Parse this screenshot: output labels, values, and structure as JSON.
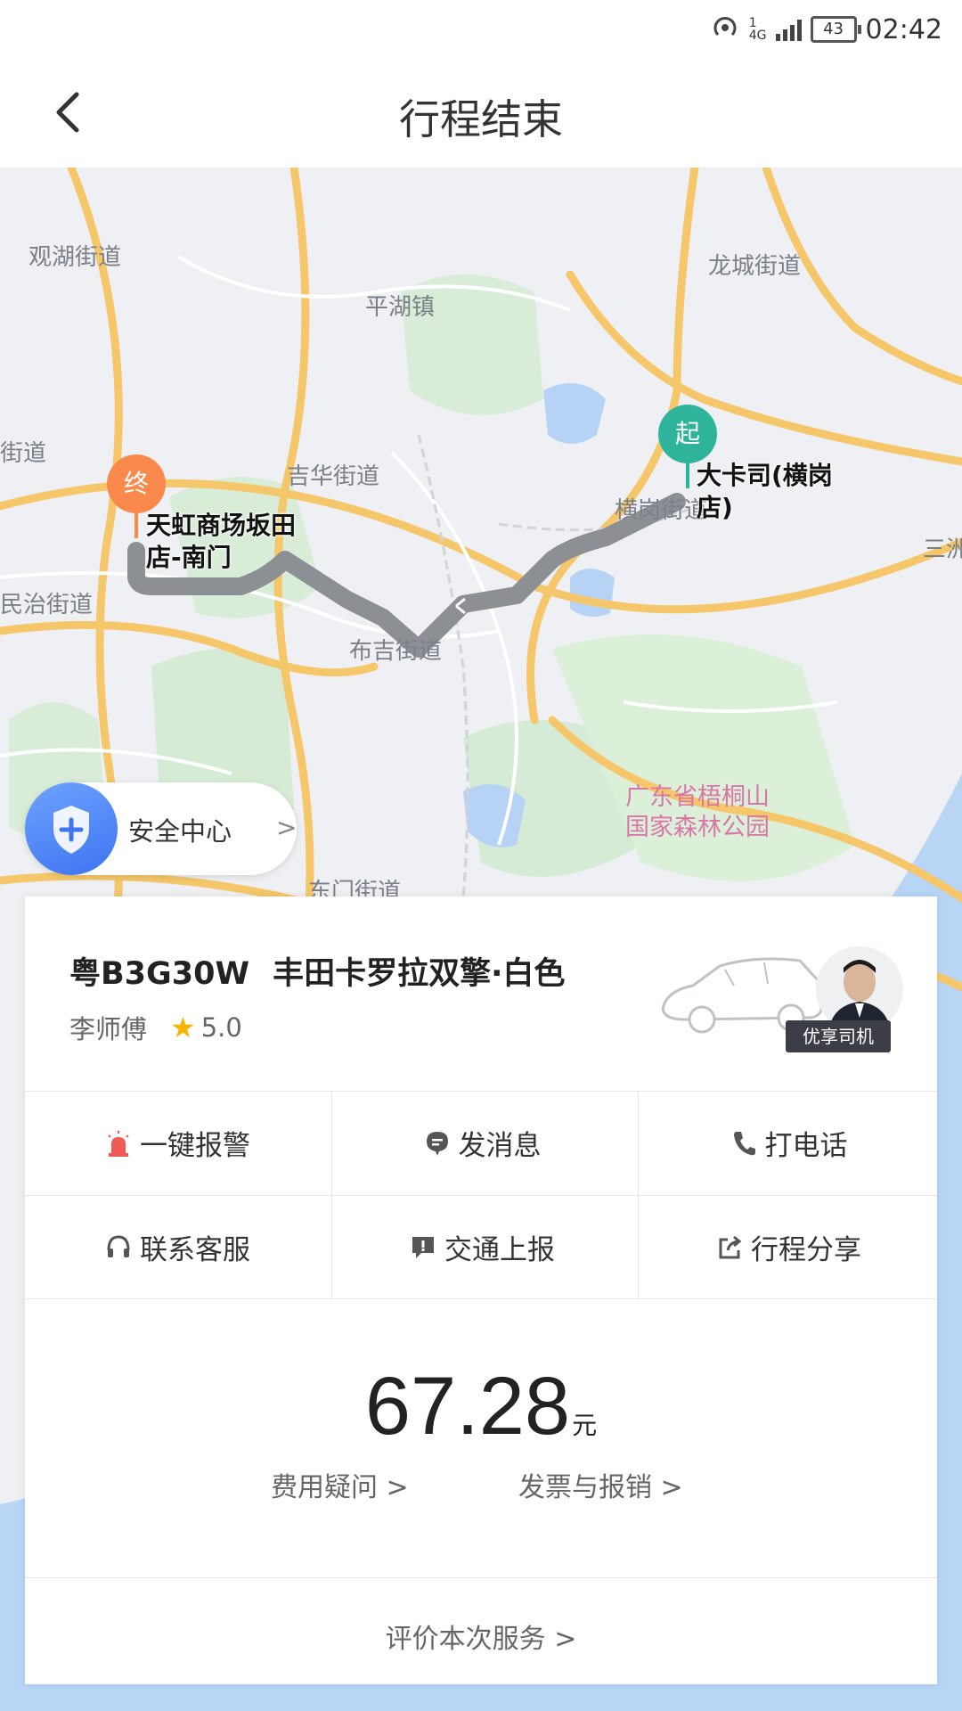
{
  "status_bar": {
    "network": "4G",
    "sim": "1",
    "battery": "43",
    "time": "02:42"
  },
  "header": {
    "title": "行程结束"
  },
  "map": {
    "labels": [
      "观湖街道",
      "平湖镇",
      "龙城街道",
      "吉华街道",
      "布吉街道",
      "民治街道",
      "街道",
      "三洲",
      "东门街道",
      "横岗街道",
      "大"
    ],
    "park_label": [
      "广东省梧桐山",
      "国家森林公园"
    ],
    "start": {
      "marker": "起",
      "name_line1": "大卡司(横岗",
      "name_line2": "店)"
    },
    "end": {
      "marker": "终",
      "name_line1": "天虹商场坂田",
      "name_line2": "店-南门"
    },
    "colors": {
      "start": "#2db49a",
      "end": "#fa8a4b",
      "route": "#8c8f94"
    }
  },
  "safety": {
    "label": "安全中心",
    "chevron": ">"
  },
  "trip": {
    "plate": "粤B3G30W",
    "car": "丰田卡罗拉双擎·白色",
    "driver": "李师傅",
    "rating": "5.0",
    "badge": "优享司机"
  },
  "actions": [
    {
      "label": "一键报警",
      "icon": "alarm-icon"
    },
    {
      "label": "发消息",
      "icon": "message-icon"
    },
    {
      "label": "打电话",
      "icon": "phone-icon"
    },
    {
      "label": "联系客服",
      "icon": "headset-icon"
    },
    {
      "label": "交通上报",
      "icon": "report-icon"
    },
    {
      "label": "行程分享",
      "icon": "share-icon"
    }
  ],
  "fare": {
    "amount": "67.28",
    "unit": "元",
    "question": "费用疑问 >",
    "invoice": "发票与报销 >"
  },
  "rate": {
    "label": "评价本次服务 >"
  }
}
